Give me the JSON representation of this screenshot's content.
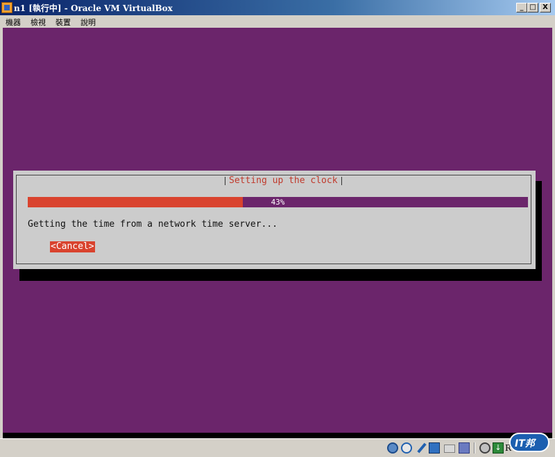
{
  "window": {
    "title": "n1 [執行中] - Oracle VM VirtualBox",
    "min_glyph": "_",
    "max_glyph": "□",
    "close_glyph": "X"
  },
  "menu": {
    "items": [
      "機器",
      "檢視",
      "裝置",
      "說明"
    ]
  },
  "dialog": {
    "title": "Setting up the clock",
    "progress_percent": 43,
    "progress_label": "43%",
    "message": "Getting the time from a network time server...",
    "cancel_label": "<Cancel>"
  },
  "statusbar": {
    "icons": [
      "hard-disk-icon",
      "optical-drive-icon",
      "usb-icon",
      "network-icon",
      "shared-folder-icon",
      "video-capture-icon",
      "cpu-icon",
      "mouse-integration-icon"
    ],
    "host_key_fragment": "R"
  },
  "watermark": {
    "text": "IT邦"
  },
  "colors": {
    "vm_background": "#6b256b",
    "dialog_background": "#cccccc",
    "accent_red": "#d9432e",
    "title_text_red": "#c0392b"
  }
}
